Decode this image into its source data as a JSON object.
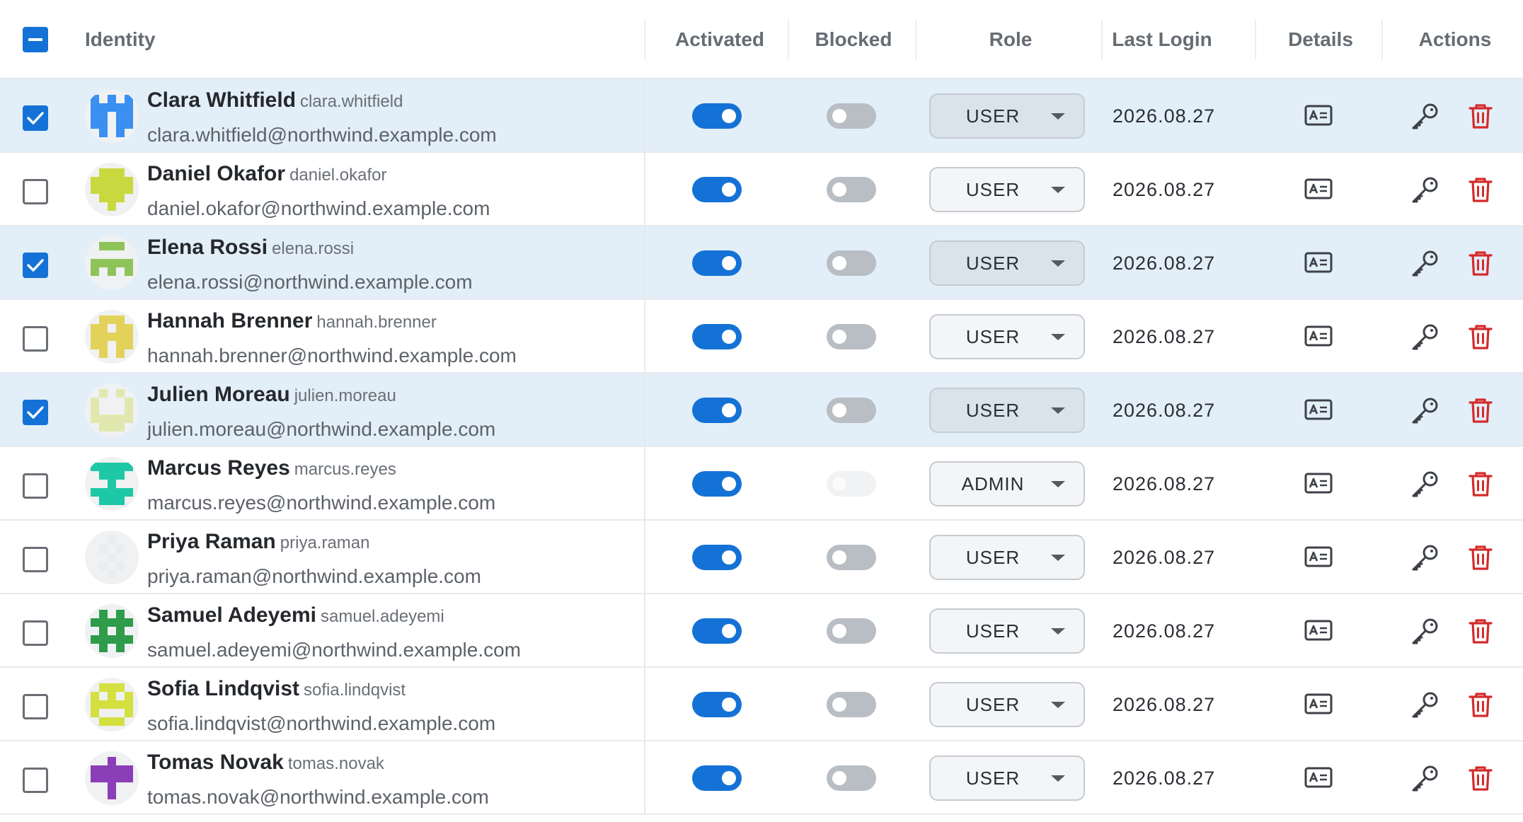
{
  "header": {
    "identity": "Identity",
    "activated": "Activated",
    "blocked": "Blocked",
    "role": "Role",
    "last_login": "Last Login",
    "details": "Details",
    "actions": "Actions",
    "select_all_state": "indeterminate"
  },
  "colors": {
    "accent": "#1472d6",
    "selected_row": "#e2eef8",
    "delete": "#d42b2b"
  },
  "users": [
    {
      "name": "Clara Whitfield",
      "username": "clara.whitfield",
      "email": "clara.whitfield@northwind.example.com",
      "selected": true,
      "activated": true,
      "blocked": false,
      "role": "USER",
      "last_login": "2026.08.27",
      "avatar_color": "#3a8ff0"
    },
    {
      "name": "Daniel Okafor",
      "username": "daniel.okafor",
      "email": "daniel.okafor@northwind.example.com",
      "selected": false,
      "activated": true,
      "blocked": false,
      "role": "USER",
      "last_login": "2026.08.27",
      "avatar_color": "#c8d940"
    },
    {
      "name": "Elena Rossi",
      "username": "elena.rossi",
      "email": "elena.rossi@northwind.example.com",
      "selected": true,
      "activated": true,
      "blocked": false,
      "role": "USER",
      "last_login": "2026.08.27",
      "avatar_color": "#8ec35a"
    },
    {
      "name": "Hannah Brenner",
      "username": "hannah.brenner",
      "email": "hannah.brenner@northwind.example.com",
      "selected": false,
      "activated": true,
      "blocked": false,
      "role": "USER",
      "last_login": "2026.08.27",
      "avatar_color": "#e3d25a"
    },
    {
      "name": "Julien Moreau",
      "username": "julien.moreau",
      "email": "julien.moreau@northwind.example.com",
      "selected": true,
      "activated": true,
      "blocked": false,
      "role": "USER",
      "last_login": "2026.08.27",
      "avatar_color": "#e0e8b0"
    },
    {
      "name": "Marcus Reyes",
      "username": "marcus.reyes",
      "email": "marcus.reyes@northwind.example.com",
      "selected": false,
      "activated": true,
      "blocked": false,
      "role": "ADMIN",
      "last_login": "2026.08.27",
      "avatar_color": "#1ec7a6"
    },
    {
      "name": "Priya Raman",
      "username": "priya.raman",
      "email": "priya.raman@northwind.example.com",
      "selected": false,
      "activated": true,
      "blocked": false,
      "role": "USER",
      "last_login": "2026.08.27",
      "avatar_color": "#eaecef"
    },
    {
      "name": "Samuel Adeyemi",
      "username": "samuel.adeyemi",
      "email": "samuel.adeyemi@northwind.example.com",
      "selected": false,
      "activated": true,
      "blocked": false,
      "role": "USER",
      "last_login": "2026.08.27",
      "avatar_color": "#2e9c4a"
    },
    {
      "name": "Sofia Lindqvist",
      "username": "sofia.lindqvist",
      "email": "sofia.lindqvist@northwind.example.com",
      "selected": false,
      "activated": true,
      "blocked": false,
      "role": "USER",
      "last_login": "2026.08.27",
      "avatar_color": "#d4e040"
    },
    {
      "name": "Tomas Novak",
      "username": "tomas.novak",
      "email": "tomas.novak@northwind.example.com",
      "selected": false,
      "activated": true,
      "blocked": false,
      "role": "USER",
      "last_login": "2026.08.27",
      "avatar_color": "#8a3fb8"
    }
  ]
}
